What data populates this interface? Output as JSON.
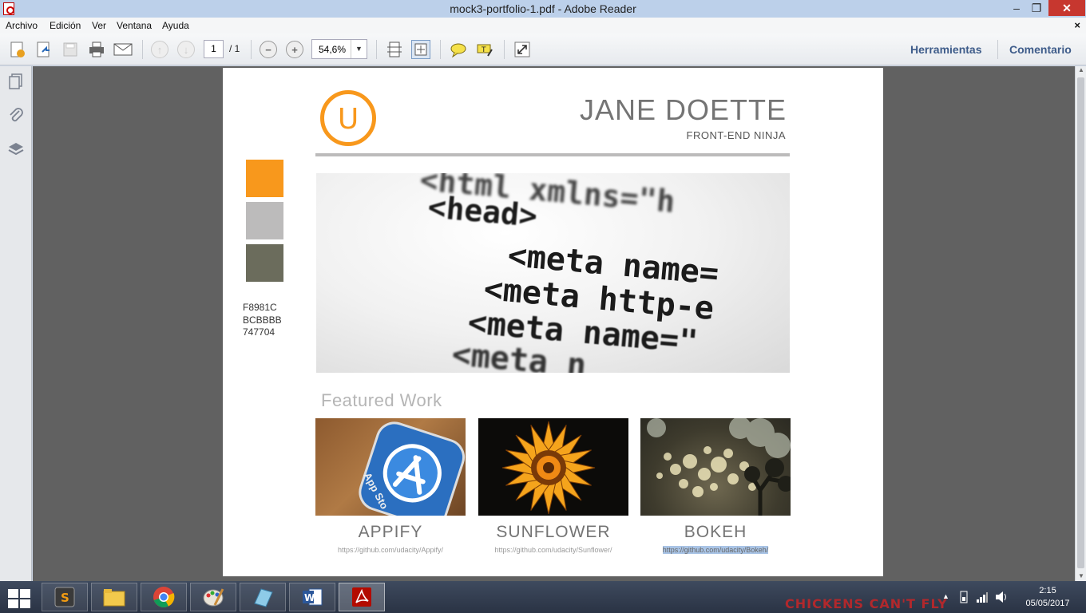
{
  "window": {
    "title": "mock3-portfolio-1.pdf - Adobe Reader",
    "min": "–",
    "max": "❐",
    "close": "✕"
  },
  "menu": {
    "items": [
      "Archivo",
      "Edición",
      "Ver",
      "Ventana",
      "Ayuda"
    ],
    "doc_close": "×"
  },
  "toolbar": {
    "page_current": "1",
    "page_total": "/ 1",
    "zoom": "54,6%",
    "tools_label": "Herramientas",
    "comment_label": "Comentario"
  },
  "document": {
    "logo_letter": "U",
    "name": "JANE DOETTE",
    "subtitle": "FRONT-END NINJA",
    "palette": [
      {
        "hex": "F8981C",
        "color": "#f8981c"
      },
      {
        "hex": "BCBBBB",
        "color": "#bcbbbb"
      },
      {
        "hex": "747704",
        "color": "#6b6c5c"
      }
    ],
    "hero_code": [
      "<html xmlns=\"h",
      "<head>",
      "<meta name=",
      "<meta http-e",
      "<meta name=\"",
      "<meta n"
    ],
    "featured_heading": "Featured Work",
    "projects": [
      {
        "title": "APPIFY",
        "link": "https://github.com/udacity/Appify/",
        "image_label": "App Sto"
      },
      {
        "title": "SUNFLOWER",
        "link": "https://github.com/udacity/Sunflower/"
      },
      {
        "title": "BOKEH",
        "link": "https://github.com/udacity/Bokeh/"
      }
    ]
  },
  "taskbar": {
    "time": "2:15",
    "date": "05/05/2017",
    "wallpaper_text": "CHICKENS CAN'T FLY",
    "apps": [
      "sublime-text",
      "file-explorer",
      "chrome",
      "paint",
      "notepad",
      "word",
      "adobe-reader"
    ]
  }
}
